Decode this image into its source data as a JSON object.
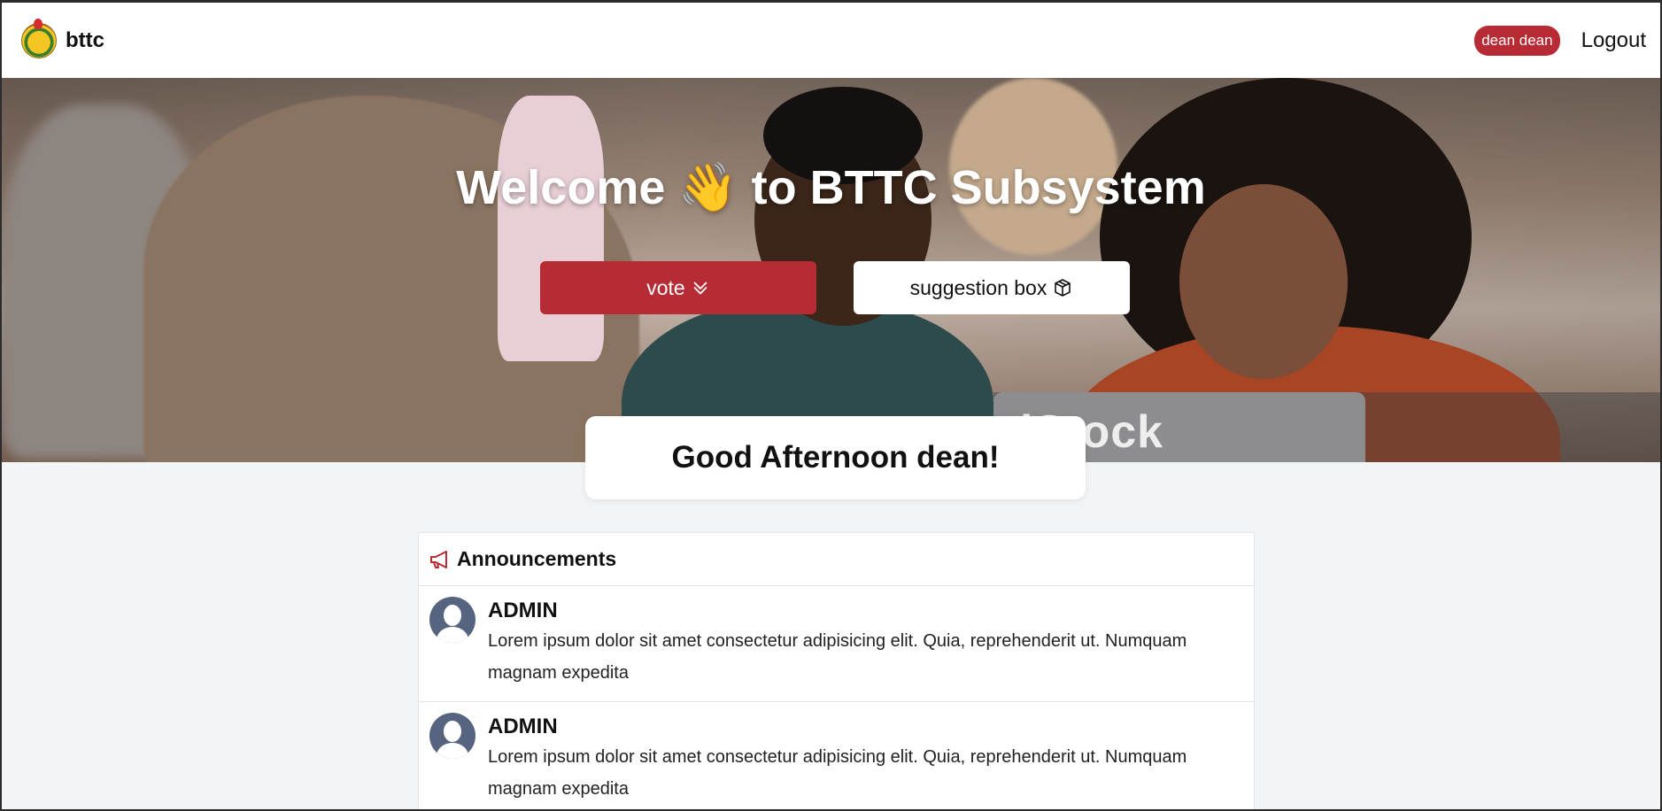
{
  "navbar": {
    "brand_name": "bttc",
    "user_badge": "dean dean",
    "logout_label": "Logout"
  },
  "hero": {
    "title_before": "Welcome",
    "wave_emoji": "👋",
    "title_after": "to BTTC Subsystem",
    "vote_label": "vote",
    "suggestion_label": "suggestion box",
    "watermark": "iStock"
  },
  "greeting": "Good Afternoon dean!",
  "announcements": {
    "title": "Announcements",
    "items": [
      {
        "author": "ADMIN",
        "text": "Lorem ipsum dolor sit amet consectetur adipisicing elit. Quia, reprehenderit ut. Numquam magnam expedita"
      },
      {
        "author": "ADMIN",
        "text": "Lorem ipsum dolor sit amet consectetur adipisicing elit. Quia, reprehenderit ut. Numquam magnam expedita"
      }
    ]
  },
  "colors": {
    "accent": "#b72b34",
    "page_bg": "#f3f4f6"
  }
}
